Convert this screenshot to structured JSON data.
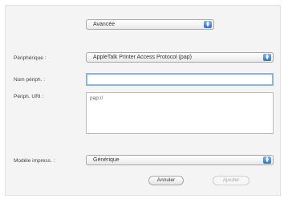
{
  "top_popup": {
    "value": "Avancée"
  },
  "device": {
    "label": "Périphérique :",
    "value": "AppleTalk Printer Access Protocol (pap)"
  },
  "device_name": {
    "label": "Nom périph. :",
    "value": ""
  },
  "device_url": {
    "label": "Périph. URI :",
    "value": "pap://"
  },
  "model": {
    "label": "Modèle impress. :",
    "value": "Générique"
  },
  "buttons": {
    "cancel": "Annuler",
    "add": "Ajouter"
  }
}
